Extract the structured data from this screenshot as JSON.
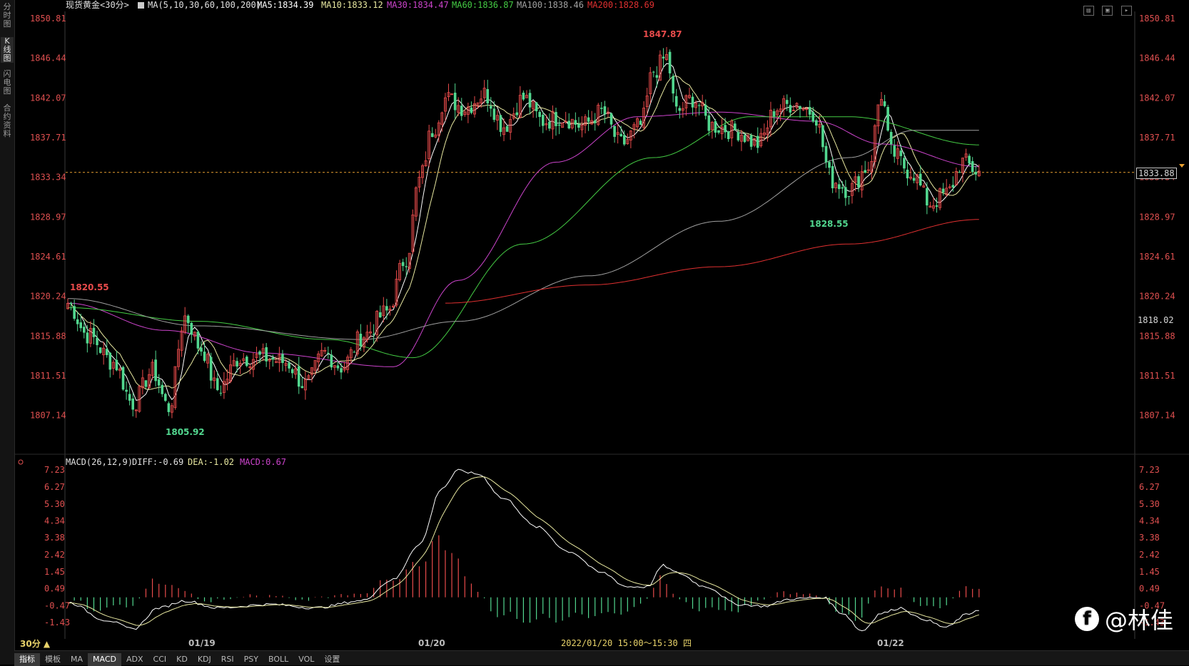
{
  "left_tabs": [
    "分时图",
    "K线图",
    "闪电图",
    "合约资料"
  ],
  "active_left_tab": 1,
  "header": {
    "instrument": "现货黄金<30分>",
    "ma_label": "MA(5,10,30,60,100,200)",
    "ma5": "MA5:1834.39",
    "ma10": "MA10:1833.12",
    "ma30": "MA30:1834.47",
    "ma60": "MA60:1836.87",
    "ma100": "MA100:1838.46",
    "ma200": "MA200:1828.69"
  },
  "macd_header": {
    "label": "MACD(26,12,9)",
    "diff": "DIFF:-0.69",
    "dea": "DEA:-1.02",
    "macd": "MACD:0.67"
  },
  "price_axis": [
    "1850.81",
    "1846.44",
    "1842.07",
    "1837.71",
    "1833.34",
    "1828.97",
    "1824.61",
    "1820.24",
    "1815.88",
    "1811.51",
    "1807.14"
  ],
  "right_extra_label": "1818.02",
  "current_price": "1833.88",
  "macd_axis": [
    "7.23",
    "6.27",
    "5.30",
    "4.34",
    "3.38",
    "2.42",
    "1.45",
    "0.49",
    "-0.47",
    "-1.43"
  ],
  "date_labels": [
    "01/19",
    "01/20",
    "01/22"
  ],
  "crosshair_time": "2022/01/20 15:00～15:30 四",
  "annotations": {
    "high": "1847.87",
    "low": "1805.92",
    "open_label": "1820.55",
    "mid_low": "1828.55"
  },
  "period": "30分 ▲",
  "bottom_tabs": [
    "指标",
    "模板",
    "MA",
    "MACD",
    "ADX",
    "CCI",
    "KD",
    "KDJ",
    "RSI",
    "PSY",
    "BOLL",
    "VOL",
    "设置"
  ],
  "active_bottom_tab": "MACD",
  "watermark": "@林佳",
  "colors": {
    "up": "#e84b4b",
    "down": "#52d78f",
    "ma5": "#ffffff",
    "ma10": "#e8e8a0",
    "ma30": "#cc44cc",
    "ma60": "#44cc44",
    "ma100": "#a0a0a0",
    "ma200": "#e03030",
    "grid": "#e05050"
  },
  "chart_data": {
    "type": "candlestick",
    "price_range": [
      1805.0,
      1851.5
    ],
    "macd_range": [
      -2.2,
      7.6
    ],
    "keys": [
      {
        "i": 0,
        "p": 1819.5
      },
      {
        "i": 6,
        "p": 1816.0
      },
      {
        "i": 14,
        "p": 1813.0
      },
      {
        "i": 20,
        "p": 1808.5
      },
      {
        "i": 26,
        "p": 1812.0
      },
      {
        "i": 31,
        "p": 1808.0
      },
      {
        "i": 36,
        "p": 1818.0
      },
      {
        "i": 41,
        "p": 1814.5
      },
      {
        "i": 46,
        "p": 1810.0
      },
      {
        "i": 53,
        "p": 1813.5
      },
      {
        "i": 60,
        "p": 1813.5
      },
      {
        "i": 67,
        "p": 1813.0
      },
      {
        "i": 73,
        "p": 1810.5
      },
      {
        "i": 79,
        "p": 1814.0
      },
      {
        "i": 84,
        "p": 1812.5
      },
      {
        "i": 91,
        "p": 1816.0
      },
      {
        "i": 98,
        "p": 1818.5
      },
      {
        "i": 104,
        "p": 1824.5
      },
      {
        "i": 108,
        "p": 1833.0
      },
      {
        "i": 112,
        "p": 1838.5
      },
      {
        "i": 116,
        "p": 1842.0
      },
      {
        "i": 122,
        "p": 1841.0
      },
      {
        "i": 128,
        "p": 1842.5
      },
      {
        "i": 134,
        "p": 1839.0
      },
      {
        "i": 140,
        "p": 1842.0
      },
      {
        "i": 146,
        "p": 1839.5
      },
      {
        "i": 152,
        "p": 1840.0
      },
      {
        "i": 158,
        "p": 1839.0
      },
      {
        "i": 164,
        "p": 1840.5
      },
      {
        "i": 170,
        "p": 1837.0
      },
      {
        "i": 176,
        "p": 1839.0
      },
      {
        "i": 180,
        "p": 1845.0
      },
      {
        "i": 184,
        "p": 1846.5
      },
      {
        "i": 187,
        "p": 1840.5
      },
      {
        "i": 192,
        "p": 1842.0
      },
      {
        "i": 198,
        "p": 1839.0
      },
      {
        "i": 205,
        "p": 1838.5
      },
      {
        "i": 212,
        "p": 1837.0
      },
      {
        "i": 218,
        "p": 1841.0
      },
      {
        "i": 224,
        "p": 1841.5
      },
      {
        "i": 229,
        "p": 1840.5
      },
      {
        "i": 235,
        "p": 1833.0
      },
      {
        "i": 240,
        "p": 1832.0
      },
      {
        "i": 246,
        "p": 1834.5
      },
      {
        "i": 250,
        "p": 1842.5
      },
      {
        "i": 253,
        "p": 1836.0
      },
      {
        "i": 259,
        "p": 1834.0
      },
      {
        "i": 265,
        "p": 1830.5
      },
      {
        "i": 270,
        "p": 1831.5
      },
      {
        "i": 275,
        "p": 1835.0
      },
      {
        "i": 280,
        "p": 1833.9
      }
    ],
    "macd_keys": [
      {
        "i": 0,
        "d": -0.3
      },
      {
        "i": 12,
        "d": -1.3
      },
      {
        "i": 20,
        "d": -1.8
      },
      {
        "i": 28,
        "d": -0.6
      },
      {
        "i": 36,
        "d": -0.2
      },
      {
        "i": 46,
        "d": -0.6
      },
      {
        "i": 62,
        "d": -0.4
      },
      {
        "i": 76,
        "d": -0.6
      },
      {
        "i": 90,
        "d": -0.2
      },
      {
        "i": 100,
        "d": 1.0
      },
      {
        "i": 108,
        "d": 3.0
      },
      {
        "i": 115,
        "d": 6.2
      },
      {
        "i": 120,
        "d": 7.2
      },
      {
        "i": 126,
        "d": 7.0
      },
      {
        "i": 134,
        "d": 5.6
      },
      {
        "i": 144,
        "d": 4.0
      },
      {
        "i": 154,
        "d": 2.6
      },
      {
        "i": 164,
        "d": 1.4
      },
      {
        "i": 172,
        "d": 0.6
      },
      {
        "i": 178,
        "d": 0.6
      },
      {
        "i": 183,
        "d": 1.8
      },
      {
        "i": 187,
        "d": 1.4
      },
      {
        "i": 196,
        "d": 0.6
      },
      {
        "i": 206,
        "d": -0.4
      },
      {
        "i": 214,
        "d": -0.5
      },
      {
        "i": 222,
        "d": -0.1
      },
      {
        "i": 232,
        "d": 0.0
      },
      {
        "i": 238,
        "d": -0.9
      },
      {
        "i": 244,
        "d": -1.9
      },
      {
        "i": 250,
        "d": -0.9
      },
      {
        "i": 256,
        "d": -0.6
      },
      {
        "i": 262,
        "d": -1.2
      },
      {
        "i": 270,
        "d": -1.7
      },
      {
        "i": 276,
        "d": -1.0
      },
      {
        "i": 280,
        "d": -0.69
      }
    ],
    "ma_anchors": {
      "ma30": [
        {
          "i": 0,
          "p": 1819.5
        },
        {
          "i": 30,
          "p": 1816.5
        },
        {
          "i": 60,
          "p": 1814.0
        },
        {
          "i": 100,
          "p": 1812.5
        },
        {
          "i": 120,
          "p": 1822.0
        },
        {
          "i": 150,
          "p": 1835.0
        },
        {
          "i": 175,
          "p": 1840.0
        },
        {
          "i": 200,
          "p": 1840.5
        },
        {
          "i": 230,
          "p": 1839.5
        },
        {
          "i": 250,
          "p": 1837.0
        },
        {
          "i": 280,
          "p": 1834.5
        }
      ],
      "ma60": [
        {
          "i": 0,
          "p": 1819.0
        },
        {
          "i": 40,
          "p": 1817.5
        },
        {
          "i": 80,
          "p": 1815.5
        },
        {
          "i": 106,
          "p": 1813.5
        },
        {
          "i": 140,
          "p": 1826.0
        },
        {
          "i": 180,
          "p": 1835.5
        },
        {
          "i": 210,
          "p": 1840.0
        },
        {
          "i": 240,
          "p": 1840.0
        },
        {
          "i": 280,
          "p": 1836.9
        }
      ],
      "ma100": [
        {
          "i": 0,
          "p": 1820.0
        },
        {
          "i": 40,
          "p": 1817.0
        },
        {
          "i": 90,
          "p": 1815.5
        },
        {
          "i": 120,
          "p": 1817.5
        },
        {
          "i": 160,
          "p": 1822.5
        },
        {
          "i": 200,
          "p": 1828.5
        },
        {
          "i": 240,
          "p": 1835.5
        },
        {
          "i": 260,
          "p": 1838.5
        },
        {
          "i": 280,
          "p": 1838.5
        }
      ],
      "ma200": [
        {
          "i": 116,
          "p": 1819.5
        },
        {
          "i": 160,
          "p": 1821.5
        },
        {
          "i": 200,
          "p": 1823.5
        },
        {
          "i": 240,
          "p": 1826.0
        },
        {
          "i": 280,
          "p": 1828.7
        }
      ]
    }
  }
}
